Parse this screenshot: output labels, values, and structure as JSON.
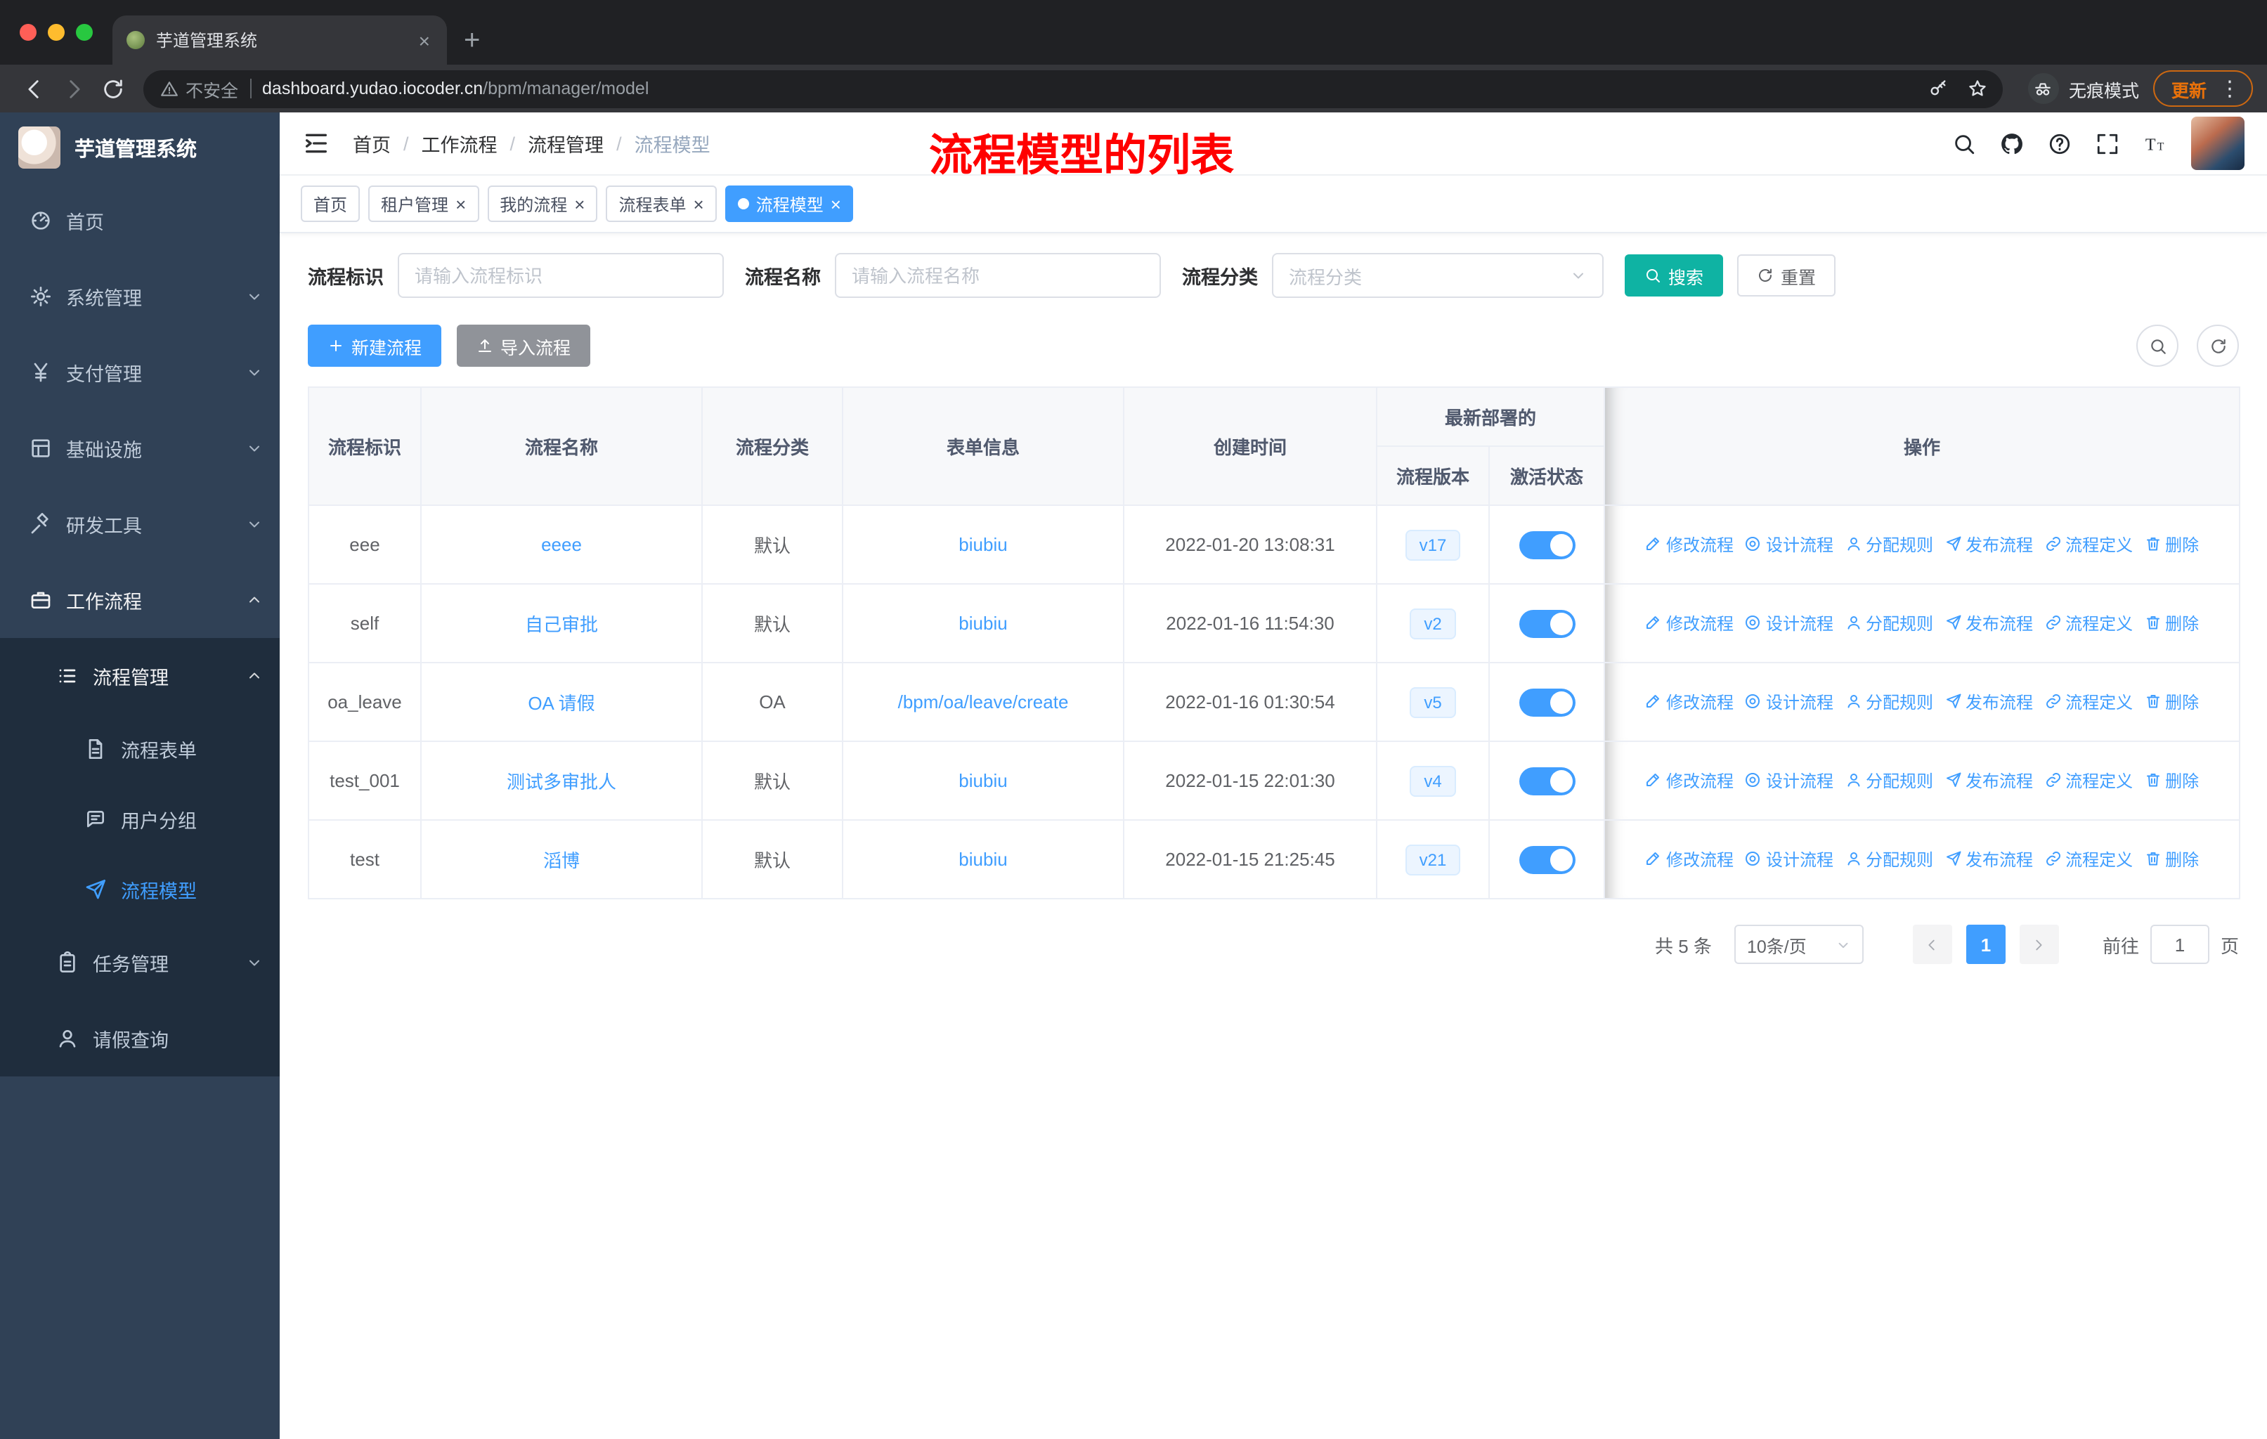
{
  "colors": {
    "primary": "#409eff",
    "search_teal": "#0fb3a3",
    "sidebar_bg": "#304156",
    "submenu_bg": "#1f2d3d",
    "annotation_red": "#ff0000",
    "link_blue": "#409eff",
    "update_orange": "#e8710a",
    "version_tag_bg": "#ecf5ff"
  },
  "browser": {
    "tab_title": "芋道管理系统",
    "security_label": "不安全",
    "url_host": "dashboard.yudao.iocoder.cn",
    "url_path": "/bpm/manager/model",
    "incognito_label": "无痕模式",
    "update_label": "更新"
  },
  "sidebar": {
    "logo_title": "芋道管理系统",
    "items": [
      {
        "label": "首页",
        "icon": "i-gauge",
        "level": 1
      },
      {
        "label": "系统管理",
        "icon": "i-gear",
        "level": 1,
        "chevron": "down"
      },
      {
        "label": "支付管理",
        "icon": "i-yen",
        "level": 1,
        "chevron": "down"
      },
      {
        "label": "基础设施",
        "icon": "i-grid",
        "level": 1,
        "chevron": "down"
      },
      {
        "label": "研发工具",
        "icon": "i-tool",
        "level": 1,
        "chevron": "down"
      },
      {
        "label": "工作流程",
        "icon": "i-case",
        "level": 1,
        "chevron": "up",
        "expanded": true
      },
      {
        "label": "流程管理",
        "icon": "i-list",
        "level": 2,
        "chevron": "up",
        "expanded": true
      },
      {
        "label": "流程表单",
        "icon": "i-doc",
        "level": 3
      },
      {
        "label": "用户分组",
        "icon": "i-chat",
        "level": 3
      },
      {
        "label": "流程模型",
        "icon": "i-plane",
        "level": 3,
        "active": true
      },
      {
        "label": "任务管理",
        "icon": "i-clip",
        "level": 2,
        "chevron": "down"
      },
      {
        "label": "请假查询",
        "icon": "i-person",
        "level": 2
      }
    ]
  },
  "header": {
    "breadcrumb": [
      "首页",
      "工作流程",
      "流程管理",
      "流程模型"
    ],
    "annotation": "流程模型的列表"
  },
  "tags": [
    {
      "label": "首页",
      "closable": false,
      "active": false
    },
    {
      "label": "租户管理",
      "closable": true,
      "active": false
    },
    {
      "label": "我的流程",
      "closable": true,
      "active": false
    },
    {
      "label": "流程表单",
      "closable": true,
      "active": false
    },
    {
      "label": "流程模型",
      "closable": true,
      "active": true
    }
  ],
  "filters": {
    "id_label": "流程标识",
    "id_placeholder": "请输入流程标识",
    "name_label": "流程名称",
    "name_placeholder": "请输入流程名称",
    "category_label": "流程分类",
    "category_placeholder": "流程分类",
    "search_label": "搜索",
    "reset_label": "重置"
  },
  "toolbar": {
    "create_label": "新建流程",
    "import_label": "导入流程"
  },
  "table": {
    "headers": {
      "id": "流程标识",
      "name": "流程名称",
      "category": "流程分类",
      "form": "表单信息",
      "created": "创建时间",
      "group": "最新部署的",
      "version": "流程版本",
      "status": "激活状态",
      "actions": "操作"
    },
    "actions": [
      {
        "label": "修改流程",
        "icon": "i-edit"
      },
      {
        "label": "设计流程",
        "icon": "i-target"
      },
      {
        "label": "分配规则",
        "icon": "i-person"
      },
      {
        "label": "发布流程",
        "icon": "i-plane"
      },
      {
        "label": "流程定义",
        "icon": "i-link"
      },
      {
        "label": "删除",
        "icon": "i-trash"
      }
    ],
    "rows": [
      {
        "id": "eee",
        "name": "eeee",
        "category": "默认",
        "form": "biubiu",
        "created": "2022-01-20 13:08:31",
        "version": "v17",
        "active": true
      },
      {
        "id": "self",
        "name": "自己审批",
        "category": "默认",
        "form": "biubiu",
        "created": "2022-01-16 11:54:30",
        "version": "v2",
        "active": true
      },
      {
        "id": "oa_leave",
        "name": "OA 请假",
        "category": "OA",
        "form": "/bpm/oa/leave/create",
        "created": "2022-01-16 01:30:54",
        "version": "v5",
        "active": true
      },
      {
        "id": "test_001",
        "name": "测试多审批人",
        "category": "默认",
        "form": "biubiu",
        "created": "2022-01-15 22:01:30",
        "version": "v4",
        "active": true
      },
      {
        "id": "test",
        "name": "滔博",
        "category": "默认",
        "form": "biubiu",
        "created": "2022-01-15 21:25:45",
        "version": "v21",
        "active": true
      }
    ]
  },
  "pagination": {
    "total": "共 5 条",
    "page_size": "10条/页",
    "page": "1",
    "goto_label": "前往",
    "goto_value": "1",
    "unit": "页"
  }
}
